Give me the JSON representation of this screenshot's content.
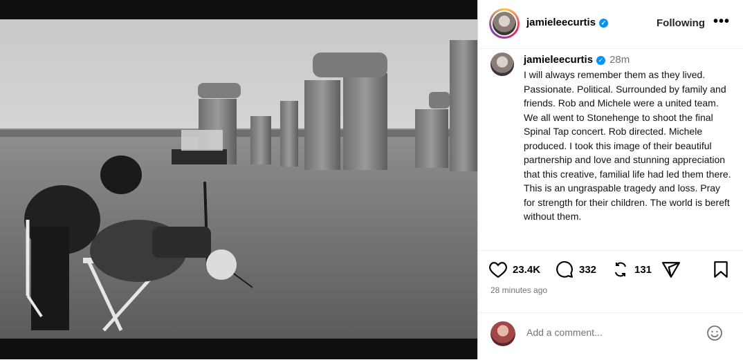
{
  "post": {
    "username": "jamieleecurtis",
    "verified_mark": "✓",
    "follow_label": "Following",
    "more_icon": "more-horizontal-icon",
    "more_label": "•••"
  },
  "caption": {
    "username": "jamieleecurtis",
    "time": "28m",
    "text": "I will always remember them as they lived. Passionate. Political. Surrounded by family and friends. Rob and Michele were a united team. We all went to Stonehenge to shoot the final Spinal Tap concert. Rob directed. Michele produced. I took this image of their beautiful partnership and love and stunning appreciation that this creative, familial life had led them there. This is an ungraspable tragedy and loss. Pray for strength for their children. The world is bereft without them."
  },
  "actions": {
    "like_icon": "heart-icon",
    "likes": "23.4K",
    "comment_icon": "comment-icon",
    "comments": "332",
    "repost_icon": "repost-icon",
    "reposts": "131",
    "share_icon": "share-icon",
    "save_icon": "bookmark-icon",
    "time_ago": "28 minutes ago"
  },
  "comment_box": {
    "placeholder": "Add a comment...",
    "emoji_icon": "emoji-icon"
  },
  "colors": {
    "verified": "#0095f6",
    "muted": "#737373"
  }
}
